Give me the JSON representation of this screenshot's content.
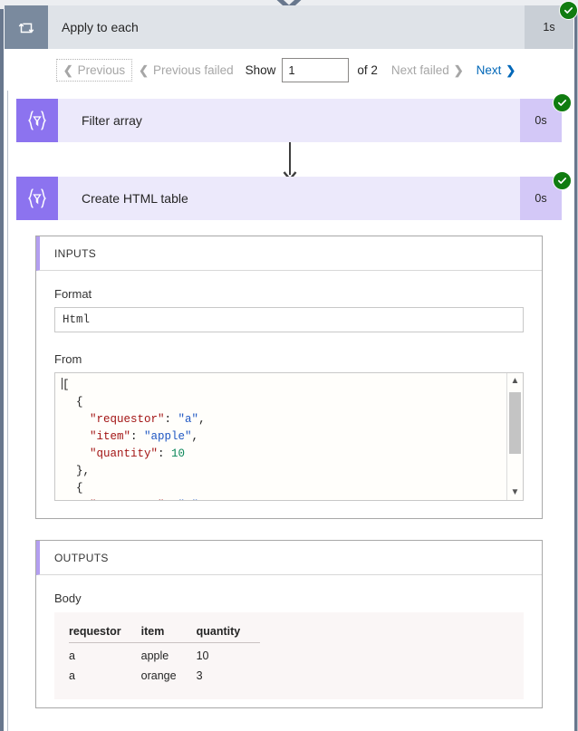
{
  "scope": {
    "title": "Apply to each",
    "duration": "1s",
    "icon": "loop-icon",
    "status": "succeeded"
  },
  "pager": {
    "previous_label": "Previous",
    "previous_failed_label": "Previous failed",
    "show_label": "Show",
    "page_value": "1",
    "of_label": "of 2",
    "next_failed_label": "Next failed",
    "next_label": "Next"
  },
  "actions": [
    {
      "title": "Filter array",
      "duration": "0s",
      "icon": "filter-braces-icon",
      "status": "succeeded"
    },
    {
      "title": "Create HTML table",
      "duration": "0s",
      "icon": "filter-braces-icon",
      "status": "succeeded"
    }
  ],
  "details": {
    "inputs_header": "INPUTS",
    "format_label": "Format",
    "format_value": "Html",
    "from_label": "From",
    "from_code": [
      [
        {
          "t": "punct",
          "v": "["
        }
      ],
      [
        {
          "t": "punct",
          "v": "  {"
        }
      ],
      [
        {
          "t": "key",
          "v": "    \"requestor\""
        },
        {
          "t": "punct",
          "v": ": "
        },
        {
          "t": "str",
          "v": "\"a\""
        },
        {
          "t": "punct",
          "v": ","
        }
      ],
      [
        {
          "t": "key",
          "v": "    \"item\""
        },
        {
          "t": "punct",
          "v": ": "
        },
        {
          "t": "str",
          "v": "\"apple\""
        },
        {
          "t": "punct",
          "v": ","
        }
      ],
      [
        {
          "t": "key",
          "v": "    \"quantity\""
        },
        {
          "t": "punct",
          "v": ": "
        },
        {
          "t": "num",
          "v": "10"
        }
      ],
      [
        {
          "t": "punct",
          "v": "  },"
        }
      ],
      [
        {
          "t": "punct",
          "v": "  {"
        }
      ],
      [
        {
          "t": "key",
          "v": "    \"requestor\""
        },
        {
          "t": "punct",
          "v": ": "
        },
        {
          "t": "str",
          "v": "\"a\""
        }
      ]
    ],
    "outputs_header": "OUTPUTS",
    "body_label": "Body",
    "body_table": {
      "columns": [
        "requestor",
        "item",
        "quantity"
      ],
      "rows": [
        [
          "a",
          "apple",
          "10"
        ],
        [
          "a",
          "orange",
          "3"
        ]
      ]
    }
  },
  "colors": {
    "accent_purple": "#8c73ef",
    "action_bg": "#ece9fb",
    "scope_header_bg": "#dfe3e8",
    "success_green": "#107c10",
    "link_blue": "#0067b8"
  }
}
